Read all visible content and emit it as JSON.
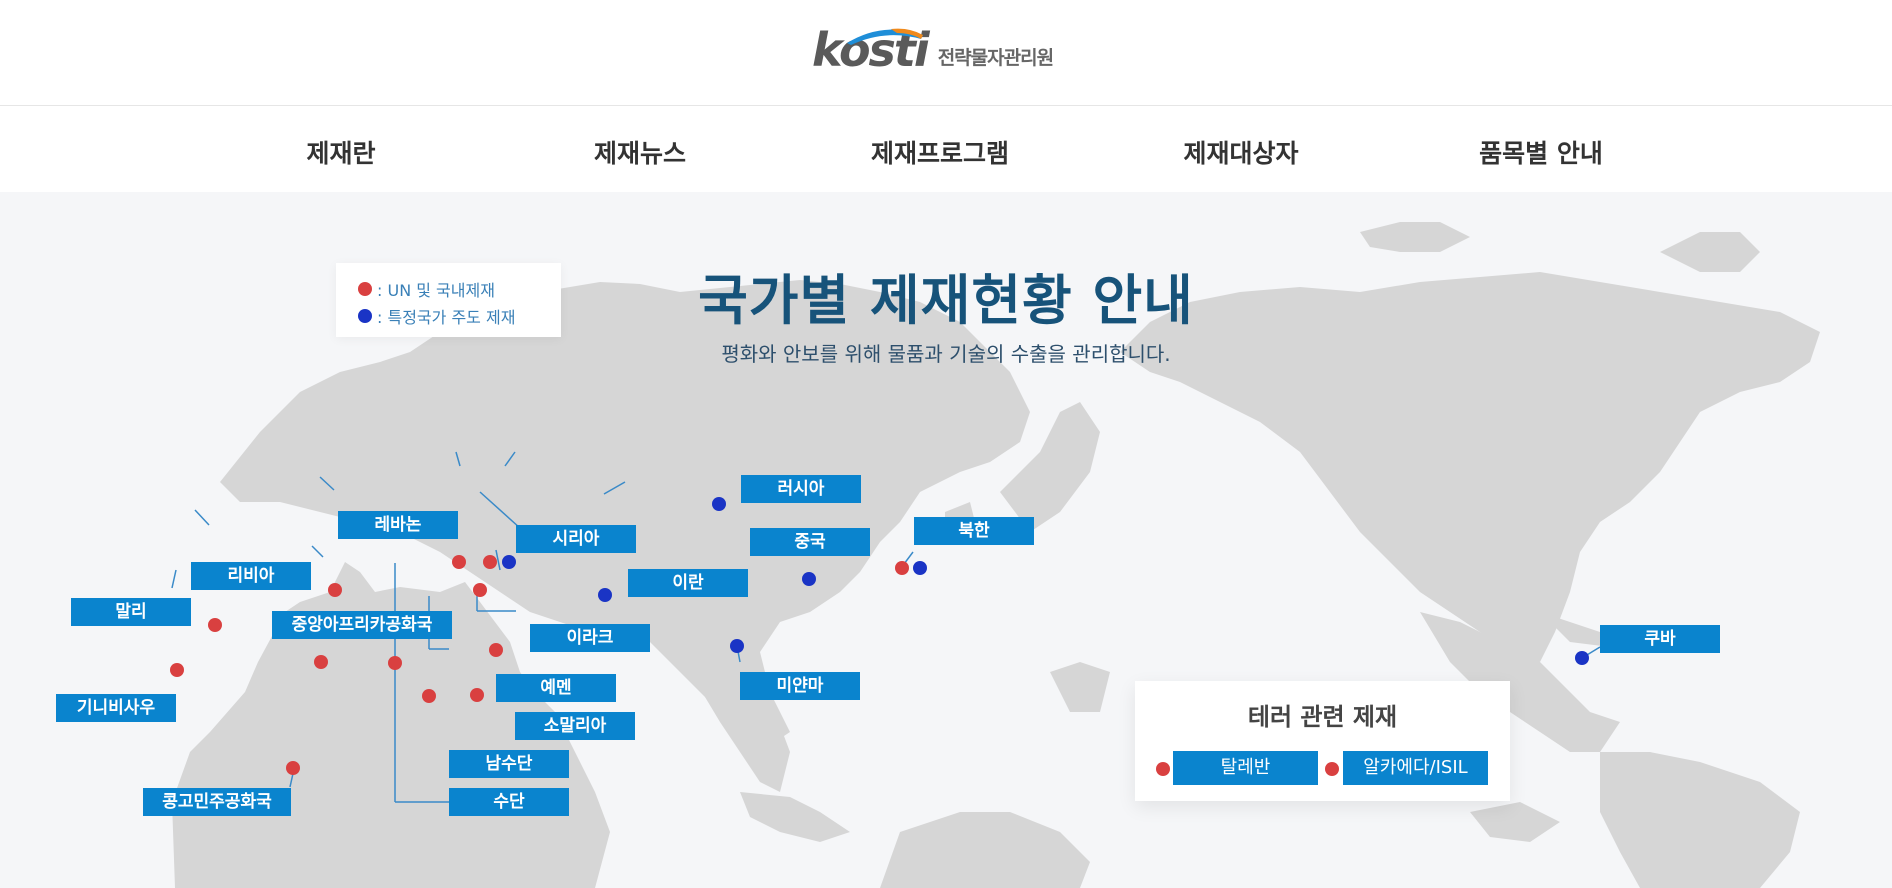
{
  "brand": {
    "logo_word": "kosti",
    "org_name": "전략물자관리원"
  },
  "nav": {
    "items": [
      "제재란",
      "제재뉴스",
      "제재프로그램",
      "제재대상자",
      "품목별 안내"
    ]
  },
  "page": {
    "title": "국가별 제재현황 안내",
    "subtitle": "평화와 안보를 위해 물품과 기술의 수출을 관리합니다."
  },
  "legend": {
    "un_label": ": UN 및 국내제재",
    "bilateral_label": ": 특정국가 주도 제재"
  },
  "colors": {
    "un": "#d94040",
    "bilateral": "#1a34c5",
    "label_bg": "#0a84ce",
    "title": "#17537a"
  },
  "countries": {
    "russia": "러시아",
    "syria": "시리아",
    "lebanon": "레바논",
    "china": "중국",
    "north_korea": "북한",
    "libya": "리비아",
    "iran": "이란",
    "mali": "말리",
    "car": "중앙아프리카공화국",
    "iraq": "이라크",
    "myanmar": "미얀마",
    "yemen": "예멘",
    "guinea_bissau": "기니비사우",
    "somalia": "소말리아",
    "south_sudan": "남수단",
    "drc": "콩고민주공화국",
    "sudan": "수단",
    "cuba": "쿠바"
  },
  "terror": {
    "title": "테러 관련 제재",
    "taliban": "탈레반",
    "alqaeda": "알카에다/ISIL"
  }
}
